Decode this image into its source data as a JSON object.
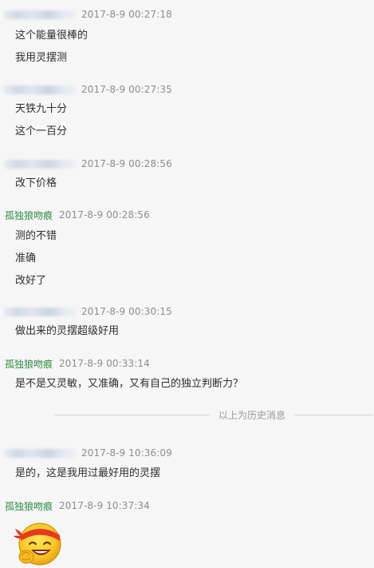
{
  "messages": [
    {
      "sender": "",
      "time": "2017-8-9 00:27:18",
      "lines": [
        "这个能量很棒的",
        "我用灵摆测"
      ]
    },
    {
      "sender": "",
      "time": "2017-8-9 00:27:35",
      "lines": [
        "天铁九十分",
        "这个一百分"
      ]
    },
    {
      "sender": "",
      "time": "2017-8-9 00:28:56",
      "lines": [
        "改下价格"
      ]
    },
    {
      "sender": "孤独狼吻痕",
      "time": "2017-8-9 00:28:56",
      "lines": [
        "测的不错",
        "准确",
        "改好了"
      ]
    },
    {
      "sender": "",
      "time": "2017-8-9 00:30:15",
      "lines": [
        "做出来的灵摆超级好用"
      ]
    },
    {
      "sender": "孤独狼吻痕",
      "time": "2017-8-9 00:33:14",
      "lines": [
        "是不是又灵敏，又准确，又有自己的独立判断力？"
      ]
    },
    {
      "sender": "",
      "time": "2017-8-9 10:36:09",
      "lines": [
        "是的，这是我用过最好用的灵摆"
      ]
    },
    {
      "sender": "孤独狼吻痕",
      "time": "2017-8-9 10:37:34",
      "lines": []
    }
  ],
  "divider": {
    "label": "以上为历史消息"
  },
  "emoji": {
    "icon": "strong-smile-emoji-icon"
  },
  "colors": {
    "sender": "#2d8a3e",
    "time": "#8d8d8d",
    "text": "#2e2e2e",
    "background": "#f6f6f6"
  }
}
